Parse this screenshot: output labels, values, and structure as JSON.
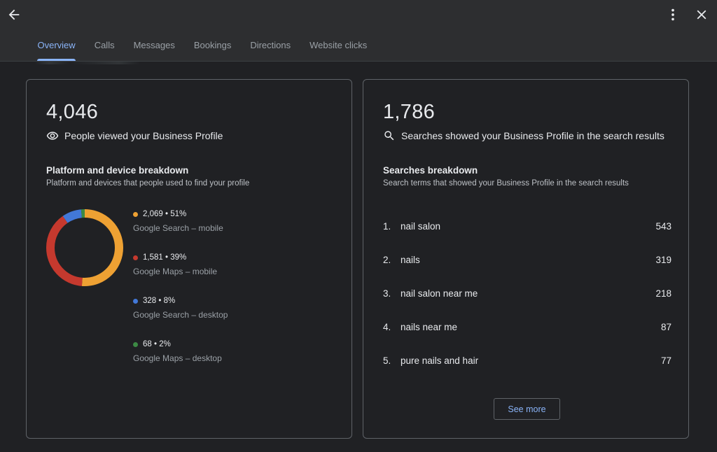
{
  "tabs": [
    {
      "label": "Overview",
      "active": true
    },
    {
      "label": "Calls",
      "active": false
    },
    {
      "label": "Messages",
      "active": false
    },
    {
      "label": "Bookings",
      "active": false
    },
    {
      "label": "Directions",
      "active": false
    },
    {
      "label": "Website clicks",
      "active": false
    }
  ],
  "icons": {
    "back": "arrow-back-icon",
    "more": "more-vert-icon",
    "close": "close-icon",
    "views": "eye-icon",
    "searches": "search-icon"
  },
  "colors": {
    "accent": "#8ab4f8",
    "orange": "#eea133",
    "red": "#c5392e",
    "blue": "#4278d8",
    "green": "#3c8a44"
  },
  "views_card": {
    "total": "4,046",
    "label": "People viewed your Business Profile",
    "section_title": "Platform and device breakdown",
    "section_subtitle": "Platform and devices that people used to find your profile",
    "breakdown": [
      {
        "value": "2,069 • 51%",
        "label": "Google Search – mobile",
        "count": 2069,
        "color": "#eea133"
      },
      {
        "value": "1,581 • 39%",
        "label": "Google Maps – mobile",
        "count": 1581,
        "color": "#c5392e"
      },
      {
        "value": "328 • 8%",
        "label": "Google Search – desktop",
        "count": 328,
        "color": "#4278d8"
      },
      {
        "value": "68 • 2%",
        "label": "Google Maps – desktop",
        "count": 68,
        "color": "#3c8a44"
      }
    ]
  },
  "searches_card": {
    "total": "1,786",
    "label": "Searches showed your Business Profile in the search results",
    "section_title": "Searches breakdown",
    "section_subtitle": "Search terms that showed your Business Profile in the search results",
    "terms": [
      {
        "rank": "1.",
        "term": "nail salon",
        "count": "543"
      },
      {
        "rank": "2.",
        "term": "nails",
        "count": "319"
      },
      {
        "rank": "3.",
        "term": "nail salon near me",
        "count": "218"
      },
      {
        "rank": "4.",
        "term": "nails near me",
        "count": "87"
      },
      {
        "rank": "5.",
        "term": "pure nails and hair",
        "count": "77"
      }
    ],
    "see_more_label": "See more"
  }
}
